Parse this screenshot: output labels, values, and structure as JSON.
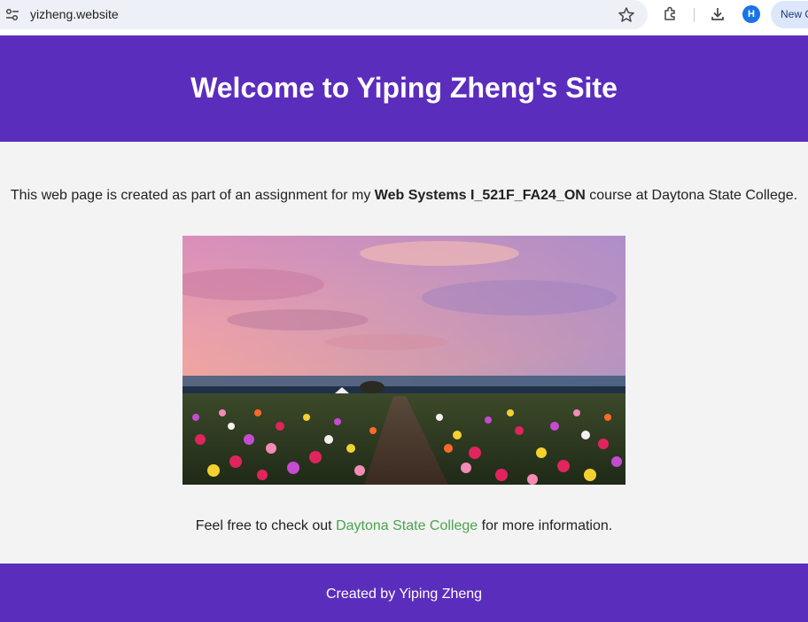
{
  "browser": {
    "url": "yizheng.website",
    "avatar_letter": "H",
    "new_chat_label": "New C"
  },
  "header": {
    "title": "Welcome to Yiping Zheng's Site"
  },
  "intro": {
    "prefix": "This web page is created as part of an assignment for my ",
    "course": "Web Systems I_521F_FA24_ON",
    "suffix": " course at Daytona State College."
  },
  "more_info": {
    "prefix": "Feel free to check out ",
    "link_text": "Daytona State College",
    "suffix": " for more information."
  },
  "footer": {
    "credit": "Created by Yiping Zheng"
  },
  "colors": {
    "brand_purple": "#5b2dbd",
    "link_green": "#4aa34e",
    "page_bg": "#f3f3f3"
  },
  "icons": [
    "tune-icon",
    "star-icon",
    "extensions-icon",
    "download-icon"
  ]
}
